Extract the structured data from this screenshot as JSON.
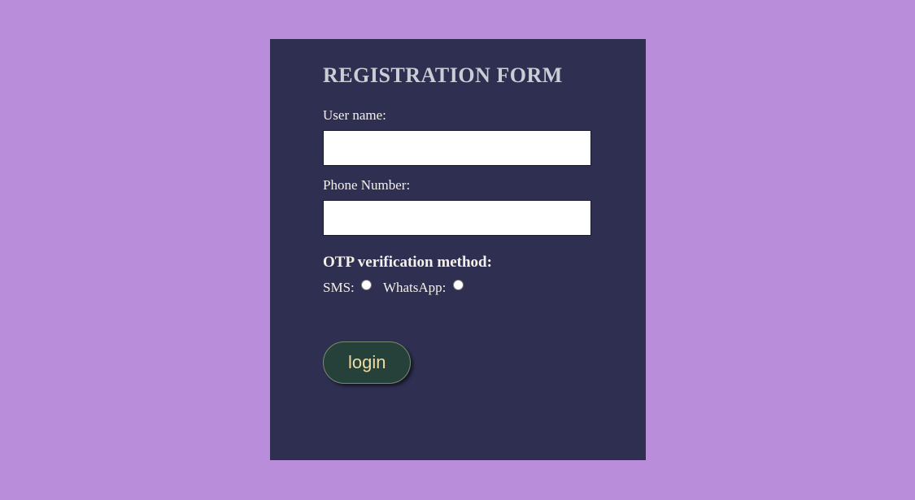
{
  "form": {
    "title": "REGISTRATION FORM",
    "username_label": "User name:",
    "username_value": "",
    "phone_label": "Phone Number:",
    "phone_value": "",
    "otp_heading": "OTP verification method:",
    "sms_label": "SMS:",
    "whatsapp_label": "WhatsApp:",
    "login_button": "login"
  }
}
